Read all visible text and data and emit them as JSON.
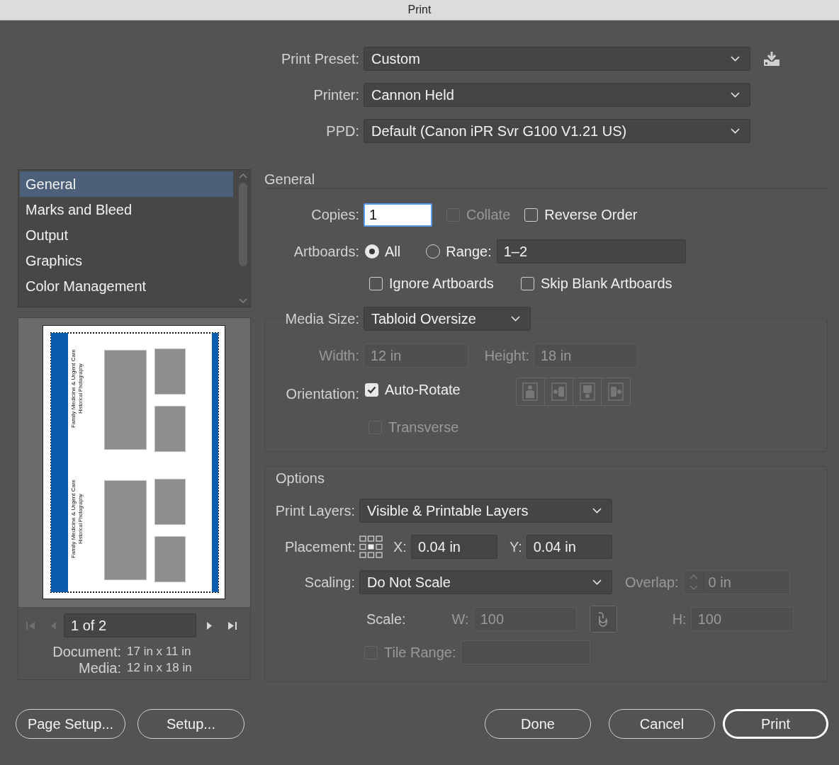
{
  "window": {
    "title": "Print"
  },
  "print_preset": {
    "label": "Print Preset:",
    "value": "Custom"
  },
  "printer": {
    "label": "Printer:",
    "value": "Cannon Held"
  },
  "ppd": {
    "label": "PPD:",
    "value": "Default (Canon iPR Svr G100 V1.21 US)"
  },
  "sidebar": {
    "items": [
      {
        "label": "General",
        "selected": true
      },
      {
        "label": "Marks and Bleed",
        "selected": false
      },
      {
        "label": "Output",
        "selected": false
      },
      {
        "label": "Graphics",
        "selected": false
      },
      {
        "label": "Color Management",
        "selected": false
      }
    ]
  },
  "preview": {
    "pages": [
      {
        "title": "Family Medicine & Urgent Care",
        "subtitle": "Historical Photography"
      },
      {
        "title": "Family Medicine & Urgent Care",
        "subtitle": "Historical Photography"
      }
    ],
    "pager": {
      "value": "1 of 2",
      "can_go_back": false,
      "can_go_forward": true
    },
    "document": {
      "label": "Document:",
      "value": "17 in x 11 in"
    },
    "media": {
      "label": "Media:",
      "value": "12 in x 18 in"
    }
  },
  "general": {
    "heading": "General",
    "copies": {
      "label": "Copies:",
      "value": "1"
    },
    "collate": {
      "label": "Collate",
      "checked": false,
      "disabled": true
    },
    "reverse_order": {
      "label": "Reverse Order",
      "checked": false,
      "disabled": false
    },
    "artboards": {
      "label": "Artboards:",
      "options": [
        {
          "label": "All",
          "selected": true
        },
        {
          "label": "Range:",
          "selected": false
        }
      ],
      "range_value": "1–2"
    },
    "ignore_artboards": {
      "label": "Ignore Artboards",
      "checked": false,
      "disabled": false
    },
    "skip_blank_artboards": {
      "label": "Skip Blank Artboards",
      "checked": false,
      "disabled": false
    },
    "media_size": {
      "label": "Media Size:",
      "value": "Tabloid Oversize"
    },
    "width": {
      "label": "Width:",
      "value": "12 in",
      "disabled": true
    },
    "height": {
      "label": "Height:",
      "value": "18 in",
      "disabled": true
    },
    "orientation": {
      "label": "Orientation:",
      "disabled": true
    },
    "auto_rotate": {
      "label": "Auto-Rotate",
      "checked": true
    },
    "transverse": {
      "label": "Transverse",
      "checked": false,
      "disabled": true
    }
  },
  "options": {
    "heading": "Options",
    "print_layers": {
      "label": "Print Layers:",
      "value": "Visible & Printable Layers"
    },
    "placement": {
      "label": "Placement:",
      "x_label": "X:",
      "x_value": "0.04 in",
      "y_label": "Y:",
      "y_value": "0.04 in"
    },
    "scaling": {
      "label": "Scaling:",
      "value": "Do Not Scale"
    },
    "overlap": {
      "label": "Overlap:",
      "value": "0 in",
      "disabled": true
    },
    "scale": {
      "label": "Scale:",
      "w_label": "W:",
      "w_value": "100",
      "h_label": "H:",
      "h_value": "100",
      "disabled": true
    },
    "tile_range": {
      "label": "Tile Range:",
      "checked": false,
      "disabled": true
    }
  },
  "buttons_left": [
    {
      "label": "Page Setup...",
      "default": false
    },
    {
      "label": "Setup...",
      "default": false
    }
  ],
  "buttons_right": [
    {
      "label": "Done",
      "default": false
    },
    {
      "label": "Cancel",
      "default": false
    },
    {
      "label": "Print",
      "default": true
    }
  ]
}
